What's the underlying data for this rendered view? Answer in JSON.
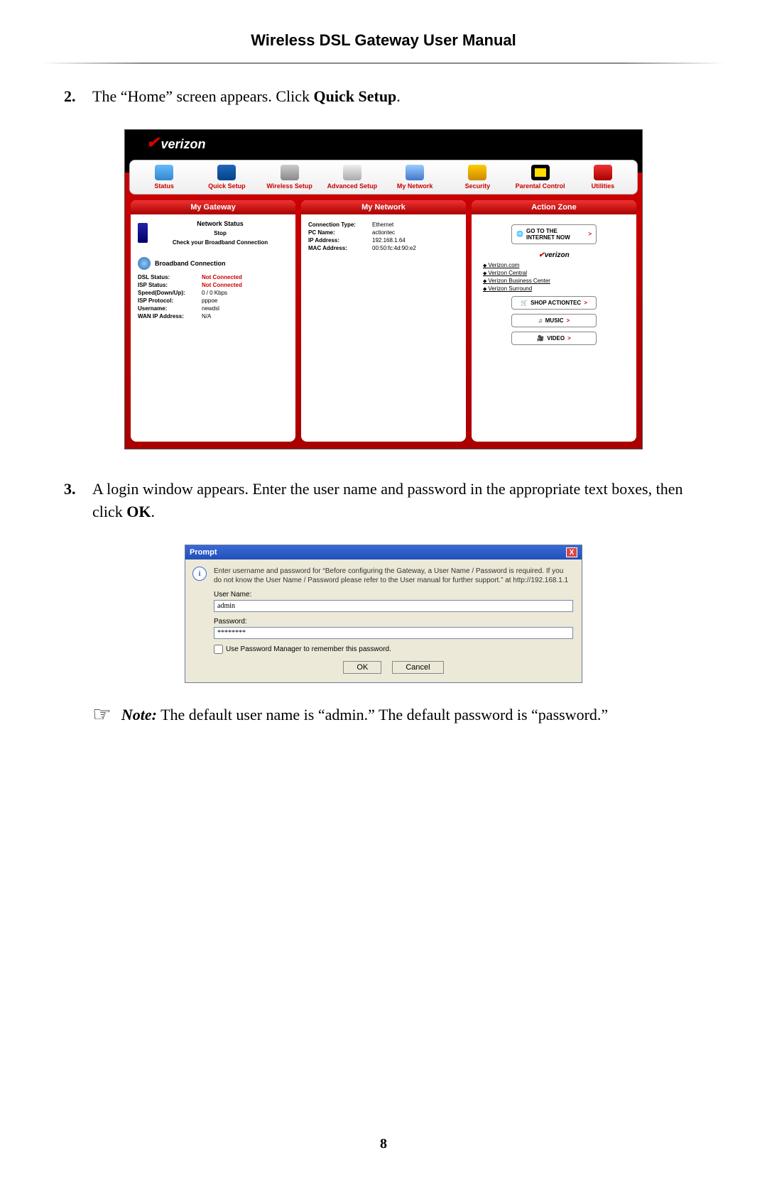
{
  "doc": {
    "title": "Wireless DSL Gateway User Manual",
    "page_number": "8"
  },
  "steps": {
    "s2_num": "2.",
    "s2_text_a": "The “Home” screen appears. Click ",
    "s2_text_b": "Quick Setup",
    "s2_text_c": ".",
    "s3_num": "3.",
    "s3_text_a": " A login window appears. Enter the user name and password in the appropriate text boxes, then click ",
    "s3_text_b": "OK",
    "s3_text_c": "."
  },
  "note": {
    "prefix": "Note:",
    "body": " The default user name is “admin.” The default password is “password.”"
  },
  "router": {
    "brand": "verizon",
    "toolbar": [
      {
        "label": "Status"
      },
      {
        "label": "Quick Setup"
      },
      {
        "label": "Wireless Setup"
      },
      {
        "label": "Advanced Setup"
      },
      {
        "label": "My Network"
      },
      {
        "label": "Security"
      },
      {
        "label": "Parental Control"
      },
      {
        "label": "Utilities"
      }
    ],
    "panel1_title": "My Gateway",
    "panel2_title": "My Network",
    "panel3_title": "Action Zone",
    "gateway": {
      "ns_title": "Network Status",
      "ns_sub": "Stop",
      "ns_check": "Check your Broadband Connection",
      "bb_title": "Broadband Connection",
      "rows": [
        {
          "k": "DSL Status:",
          "v": "Not Connected",
          "red": true
        },
        {
          "k": "ISP Status:",
          "v": "Not Connected",
          "red": true
        },
        {
          "k": "Speed(Down/Up):",
          "v": "0 / 0 Kbps"
        },
        {
          "k": "ISP Protocol:",
          "v": "pppoe"
        },
        {
          "k": "Username:",
          "v": "newdsl"
        },
        {
          "k": "WAN IP Address:",
          "v": "N/A"
        }
      ]
    },
    "network": {
      "rows": [
        {
          "k": "Connection Type:",
          "v": "Ethernet"
        },
        {
          "k": "PC Name:",
          "v": "actiontec"
        },
        {
          "k": "IP Address:",
          "v": "192.168.1.64"
        },
        {
          "k": "MAC Address:",
          "v": "00:50:fc:4d:90:e2"
        }
      ]
    },
    "action": {
      "go_internet": "GO TO THE INTERNET NOW",
      "brand_small": "verizon",
      "links": [
        "Verizon.com",
        "Verizon Central",
        "Verizon Business Center",
        "Verizon Surround"
      ],
      "shop": "SHOP ACTIONTEC",
      "music": "MUSIC",
      "video": "VIDEO",
      "chev": ">"
    }
  },
  "prompt": {
    "title": "Prompt",
    "close": "X",
    "msg": "Enter username and password for “Before configuring the Gateway, a User Name / Password is required. If you do not know the User Name / Password please refer to the User manual for further support.” at http://192.168.1.1",
    "user_label": "User Name:",
    "user_value": "admin",
    "pass_label": "Password:",
    "pass_value": "********",
    "check_label": "Use Password Manager to remember this password.",
    "ok": "OK",
    "cancel": "Cancel"
  }
}
